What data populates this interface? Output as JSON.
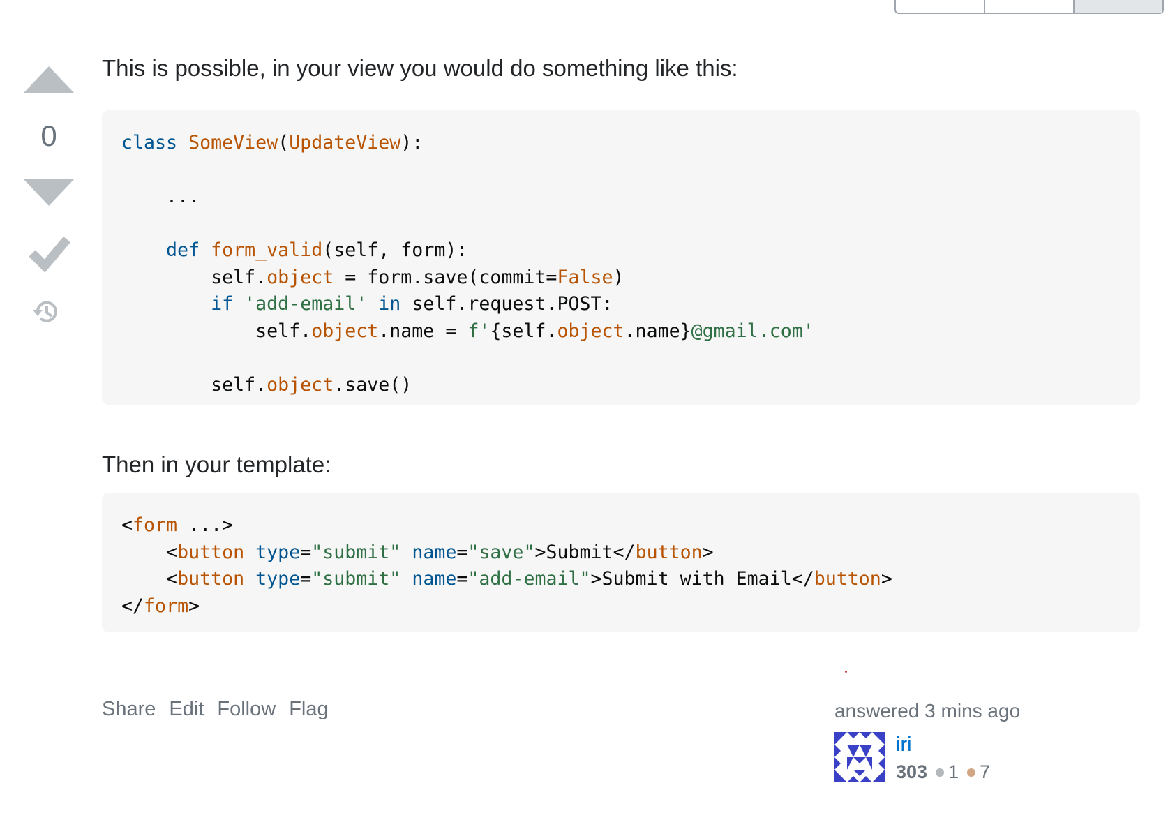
{
  "vote": {
    "count": "0"
  },
  "post": {
    "intro": "This is possible, in your view you would do something like this:",
    "template_intro": "Then in your template:"
  },
  "code1": {
    "line1_kw": "class",
    "line1_name": "SomeView",
    "line1_paren_open": "(",
    "line1_base": "UpdateView",
    "line1_rest": "):",
    "line3": "    ...",
    "line5_indent": "    ",
    "line5_kw": "def",
    "line5_name": "form_valid",
    "line5_rest": "(self, form):",
    "line6_a": "        self.",
    "line6_attr": "object",
    "line6_b": " = form.save(commit=",
    "line6_val": "False",
    "line6_c": ")",
    "line7_indent": "        ",
    "line7_kw": "if",
    "line7_str": "'add-email'",
    "line7_kw2": "in",
    "line7_rest": " self.request.POST:",
    "line8_a": "            self.",
    "line8_attr": "object",
    "line8_b": ".name = ",
    "line8_str1": "f'",
    "line8_c": "{self.",
    "line8_attr2": "object",
    "line8_d": ".name}",
    "line8_str2": "@gmail.com'",
    "line10_a": "        self.",
    "line10_attr": "object",
    "line10_b": ".save()"
  },
  "code2": {
    "form_open_lt": "<",
    "form_tag": "form",
    "form_open_rest": " ...>",
    "btn_indent": "    ",
    "lt": "<",
    "button_tag": "button",
    "attr_type": "type",
    "eq": "=",
    "val_submit": "\"submit\"",
    "attr_name": "name",
    "val_save": "\"save\"",
    "gt_submit": ">Submit</",
    "val_add_email": "\"add-email\"",
    "gt_submit_email": ">Submit with Email</",
    "gt": ">",
    "form_close_lt": "</",
    "form_close_tag": "form",
    "form_close_gt": ">"
  },
  "menu": {
    "share": "Share",
    "edit": "Edit",
    "follow": "Follow",
    "flag": "Flag"
  },
  "signature": {
    "answered": "answered 3 mins ago",
    "username": "iri",
    "reputation": "303",
    "silver_badges": "1",
    "bronze_badges": "7",
    "silver_color": "#b4b8bc",
    "bronze_color": "#d1a684"
  }
}
